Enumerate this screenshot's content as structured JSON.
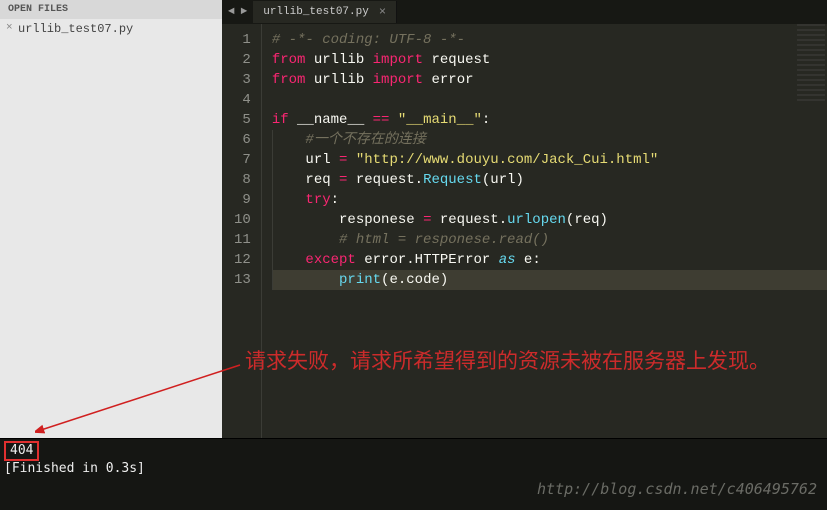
{
  "sidebar": {
    "header": "OPEN FILES",
    "files": [
      {
        "name": "urllib_test07.py"
      }
    ]
  },
  "tabs": {
    "nav_prev": "◄",
    "nav_next": "►",
    "items": [
      {
        "label": "urllib_test07.py"
      }
    ]
  },
  "code": {
    "lines": [
      {
        "n": "1",
        "tokens": [
          [
            "c-comment",
            "# -*- coding: UTF-8 -*-"
          ]
        ]
      },
      {
        "n": "2",
        "tokens": [
          [
            "c-keyword",
            "from"
          ],
          [
            "",
            " "
          ],
          [
            "c-name",
            "urllib"
          ],
          [
            "",
            " "
          ],
          [
            "c-keyword",
            "import"
          ],
          [
            "",
            " "
          ],
          [
            "c-name",
            "request"
          ]
        ]
      },
      {
        "n": "3",
        "tokens": [
          [
            "c-keyword",
            "from"
          ],
          [
            "",
            " "
          ],
          [
            "c-name",
            "urllib"
          ],
          [
            "",
            " "
          ],
          [
            "c-keyword",
            "import"
          ],
          [
            "",
            " "
          ],
          [
            "c-name",
            "error"
          ]
        ]
      },
      {
        "n": "4",
        "tokens": []
      },
      {
        "n": "5",
        "tokens": [
          [
            "c-keyword",
            "if"
          ],
          [
            "",
            " "
          ],
          [
            "c-name",
            "__name__"
          ],
          [
            "",
            " "
          ],
          [
            "c-keyword",
            "=="
          ],
          [
            "",
            " "
          ],
          [
            "c-string",
            "\"__main__\""
          ],
          [
            "",
            ":"
          ]
        ]
      },
      {
        "n": "6",
        "tokens": [
          [
            "",
            "    "
          ],
          [
            "c-comment",
            "#一个不存在的连接"
          ]
        ]
      },
      {
        "n": "7",
        "tokens": [
          [
            "",
            "    "
          ],
          [
            "c-name",
            "url"
          ],
          [
            "",
            " "
          ],
          [
            "c-keyword",
            "="
          ],
          [
            "",
            " "
          ],
          [
            "c-string",
            "\"http://www.douyu.com/Jack_Cui.html\""
          ]
        ]
      },
      {
        "n": "8",
        "tokens": [
          [
            "",
            "    "
          ],
          [
            "c-name",
            "req"
          ],
          [
            "",
            " "
          ],
          [
            "c-keyword",
            "="
          ],
          [
            "",
            " "
          ],
          [
            "c-name",
            "request"
          ],
          [
            "",
            "."
          ],
          [
            "c-func",
            "Request"
          ],
          [
            "",
            "("
          ],
          [
            "c-name",
            "url"
          ],
          [
            "",
            ")"
          ]
        ]
      },
      {
        "n": "9",
        "tokens": [
          [
            "",
            "    "
          ],
          [
            "c-keyword",
            "try"
          ],
          [
            "",
            ":"
          ]
        ]
      },
      {
        "n": "10",
        "tokens": [
          [
            "",
            "        "
          ],
          [
            "c-name",
            "responese"
          ],
          [
            "",
            " "
          ],
          [
            "c-keyword",
            "="
          ],
          [
            "",
            " "
          ],
          [
            "c-name",
            "request"
          ],
          [
            "",
            "."
          ],
          [
            "c-func",
            "urlopen"
          ],
          [
            "",
            "("
          ],
          [
            "c-name",
            "req"
          ],
          [
            "",
            ")"
          ]
        ]
      },
      {
        "n": "11",
        "tokens": [
          [
            "",
            "        "
          ],
          [
            "c-comment",
            "# html = responese.read()"
          ]
        ]
      },
      {
        "n": "12",
        "tokens": [
          [
            "",
            "    "
          ],
          [
            "c-keyword",
            "except"
          ],
          [
            "",
            " "
          ],
          [
            "c-name",
            "error"
          ],
          [
            "",
            "."
          ],
          [
            "c-name",
            "HTTPError"
          ],
          [
            "",
            " "
          ],
          [
            "c-keyword-it",
            "as"
          ],
          [
            "",
            " "
          ],
          [
            "c-name",
            "e"
          ],
          [
            "",
            ":"
          ]
        ]
      },
      {
        "n": "13",
        "tokens": [
          [
            "",
            "        "
          ],
          [
            "c-builtin",
            "print"
          ],
          [
            "",
            "("
          ],
          [
            "c-name",
            "e"
          ],
          [
            "",
            "."
          ],
          [
            "c-name",
            "code"
          ],
          [
            "",
            ")"
          ]
        ],
        "active": true
      }
    ]
  },
  "console": {
    "output_code": "404",
    "finished": "[Finished in 0.3s]"
  },
  "annotation": {
    "text": "请求失败，请求所希望得到的资源未被在服务器上发现。"
  },
  "watermark": "http://blog.csdn.net/c406495762"
}
